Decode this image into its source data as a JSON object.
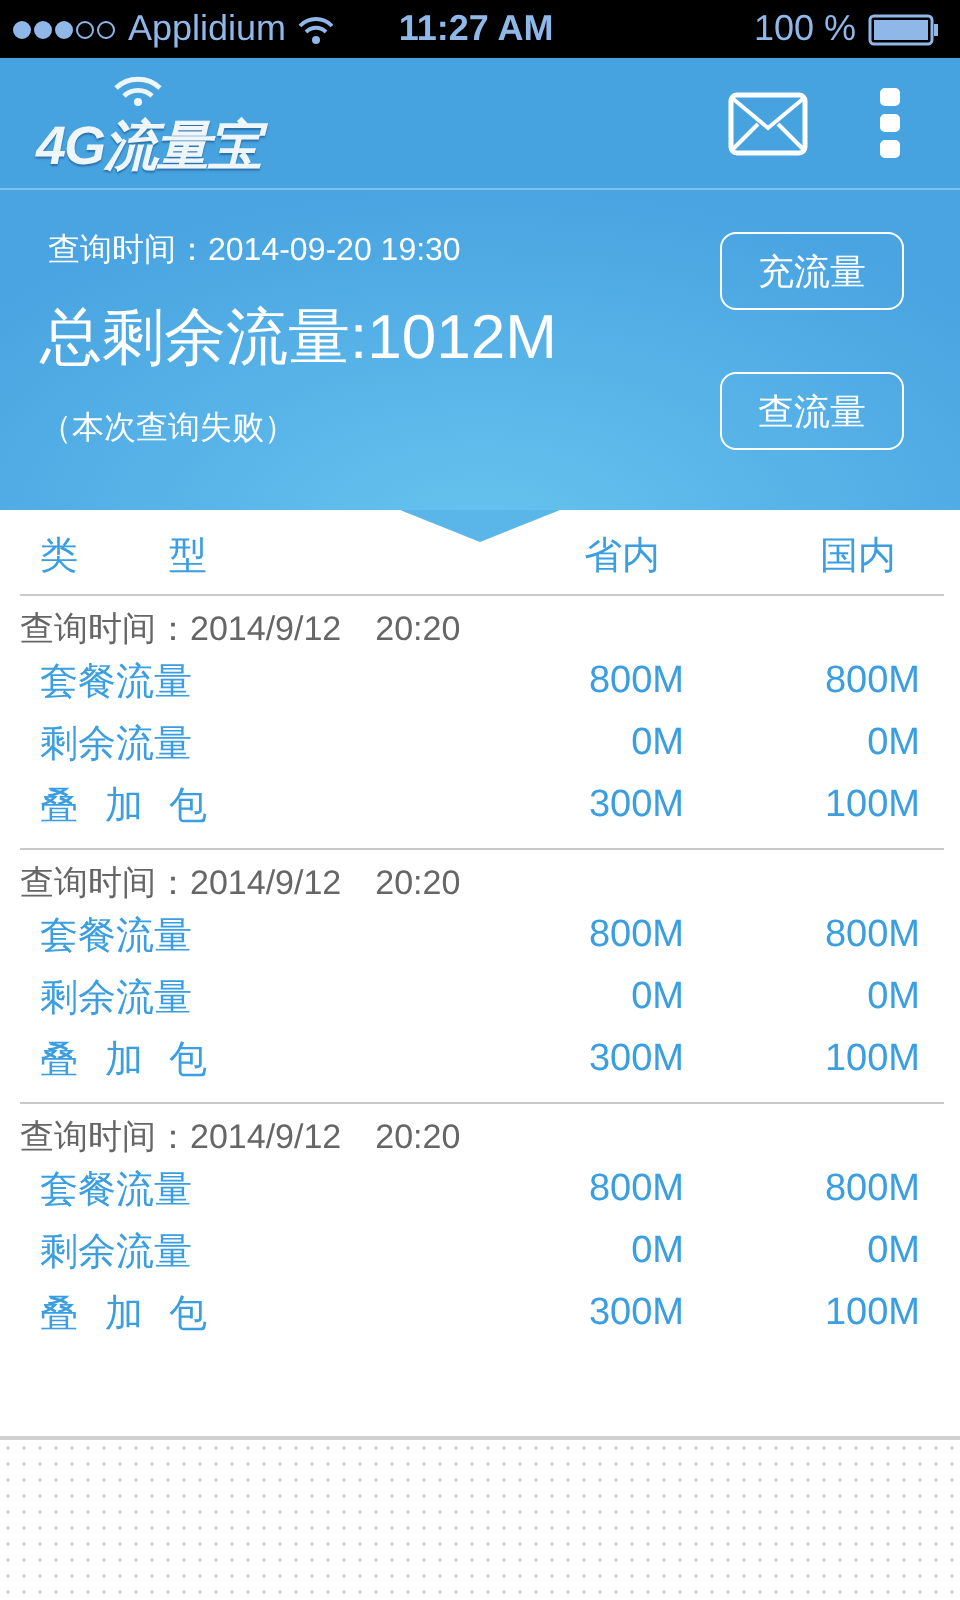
{
  "status_bar": {
    "carrier": "Applidium",
    "time": "11:27 AM",
    "battery": "100 %"
  },
  "header": {
    "logo": "4G流量宝"
  },
  "summary": {
    "query_time": "查询时间：2014-09-20 19:30",
    "total": "总剩余流量:1012M",
    "note": "（本次查询失败）",
    "buttons": [
      "充流量",
      "查流量"
    ]
  },
  "table": {
    "columns": [
      "类 型",
      "省内",
      "国内"
    ],
    "groups": [
      {
        "time": "查询时间：2014/9/12　20:20",
        "rows": [
          {
            "name": "套餐流量",
            "province": "800M",
            "national": "800M"
          },
          {
            "name": "剩余流量",
            "province": "0M",
            "national": "0M"
          },
          {
            "name": "叠 加 包",
            "province": "300M",
            "national": "100M"
          }
        ]
      },
      {
        "time": "查询时间：2014/9/12　20:20",
        "rows": [
          {
            "name": "套餐流量",
            "province": "800M",
            "national": "800M"
          },
          {
            "name": "剩余流量",
            "province": "0M",
            "national": "0M"
          },
          {
            "name": "叠 加 包",
            "province": "300M",
            "national": "100M"
          }
        ]
      },
      {
        "time": "查询时间：2014/9/12　20:20",
        "rows": [
          {
            "name": "套餐流量",
            "province": "800M",
            "national": "800M"
          },
          {
            "name": "剩余流量",
            "province": "0M",
            "national": "0M"
          },
          {
            "name": "叠 加 包",
            "province": "300M",
            "national": "100M"
          }
        ]
      }
    ]
  }
}
